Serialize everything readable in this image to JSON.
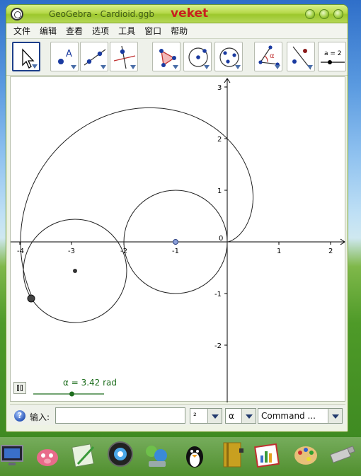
{
  "window": {
    "title": "GeoGebra - Cardioid.ggb",
    "brand": "veket"
  },
  "menu": [
    "文件",
    "编辑",
    "查看",
    "选项",
    "工具",
    "窗口",
    "帮助"
  ],
  "toolbar": {
    "tools": [
      {
        "name": "move-tool",
        "icon": "cursor-arrow-icon",
        "selected": true
      },
      {
        "name": "new-point-tool",
        "icon": "point-icon",
        "label": "A"
      },
      {
        "name": "line-tool",
        "icon": "line-icon"
      },
      {
        "name": "perpendicular-line-tool",
        "icon": "perpendicular-line-icon"
      },
      {
        "name": "polygon-tool",
        "icon": "polygon-icon"
      },
      {
        "name": "circle-tool",
        "icon": "circle-center-icon"
      },
      {
        "name": "conic-tool",
        "icon": "conic-icon"
      },
      {
        "name": "angle-tool",
        "icon": "angle-icon",
        "label": "α"
      },
      {
        "name": "reflect-tool",
        "icon": "reflect-icon"
      },
      {
        "name": "slider-tool",
        "icon": "slider-icon",
        "label": "a = 2"
      }
    ]
  },
  "graphics": {
    "axis_ticks_x": [
      "-4",
      "-3",
      "-2",
      "-1",
      "0",
      "1",
      "2"
    ],
    "axis_ticks_y": [
      "3",
      "2",
      "1",
      "-1",
      "-2"
    ],
    "slider_label": "α = 3.42 rad",
    "slider_value": 3.42,
    "slider_range": [
      0,
      6.28
    ]
  },
  "inputbar": {
    "label": "输入:",
    "help_icon": "help-icon",
    "value": "",
    "superscript_value": "²",
    "greek_value": "α",
    "command_placeholder": "Command ..."
  },
  "colors": {
    "title_green": "#9cc72d",
    "brand_red": "#c81e1e",
    "slider_green": "#1e6e1e",
    "point_blue": "#8b9fd8"
  },
  "taskbar": [
    "monitor-icon",
    "pig-icon",
    "notepad-icon",
    "media-player-icon",
    "chat-icon",
    "penguin-icon",
    "address-book-icon",
    "chart-app-icon",
    "paint-palette-icon",
    "usb-drive-icon"
  ]
}
